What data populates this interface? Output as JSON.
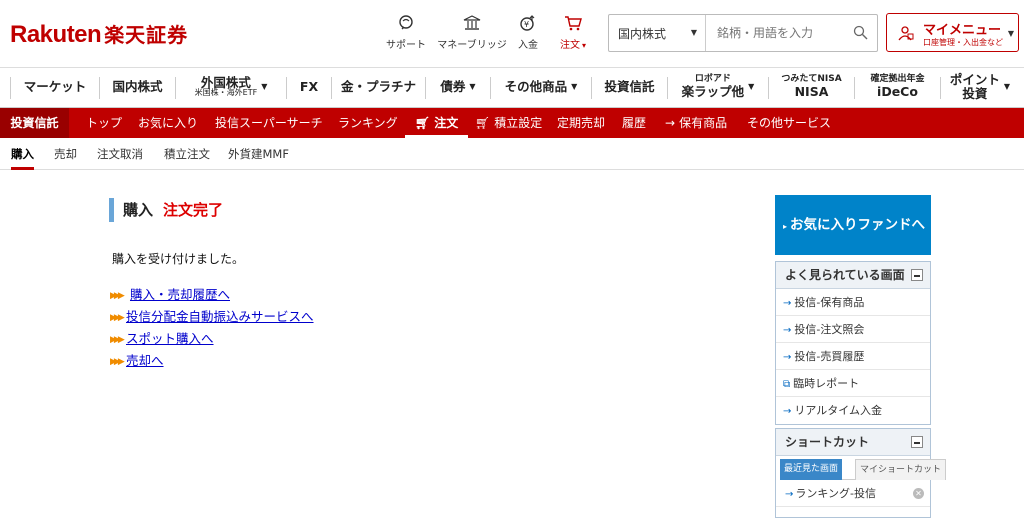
{
  "header": {
    "logo_en": "Rakuten",
    "logo_jp": "楽天証券",
    "icons": [
      {
        "label": "サポート",
        "icon": "support-icon"
      },
      {
        "label": "マネーブリッジ",
        "icon": "bank-icon"
      },
      {
        "label": "入金",
        "icon": "deposit-icon"
      },
      {
        "label": "注文",
        "icon": "cart-icon"
      }
    ],
    "order_caret": "▾",
    "search": {
      "category": "国内株式",
      "placeholder": "銘柄・用語を入力"
    },
    "mymenu": {
      "title": "マイメニュー",
      "subtitle": "口座管理・入出金など"
    }
  },
  "main_nav": [
    {
      "label": "マーケット"
    },
    {
      "label": "国内株式"
    },
    {
      "label": "外国株式",
      "sub": "米国株・海外ETF",
      "caret": true
    },
    {
      "label": "FX"
    },
    {
      "label": "金・プラチナ"
    },
    {
      "label": "債券",
      "caret": true
    },
    {
      "label": "その他商品",
      "caret": true
    },
    {
      "label": "投資信託"
    },
    {
      "label": "楽ラップ他",
      "pre": "ロボアド",
      "caret": true
    },
    {
      "label": "NISA",
      "pre": "つみたてNISA"
    },
    {
      "label": "iDeCo",
      "pre": "確定拠出年金"
    },
    {
      "label": "投資",
      "pre": "ポイント",
      "caret": true
    }
  ],
  "red_nav": {
    "first": "投資信託",
    "items": [
      "トップ",
      "お気に入り",
      "投信スーパーサーチ",
      "ランキング",
      "注文",
      "積立設定",
      "定期売却",
      "履歴",
      "保有商品",
      "その他サービス"
    ]
  },
  "sub_nav": [
    "購入",
    "売却",
    "注文取消",
    "積立注文",
    "外貨建MMF"
  ],
  "page": {
    "title": "購入",
    "status": "注文完了",
    "message": "購入を受け付けました。",
    "links": [
      "購入・売却履歴へ",
      "投信分配金自動振込みサービスへ",
      "スポット購入へ",
      "売却へ"
    ]
  },
  "sidebar": {
    "fav_button": "お気に入りファンドへ",
    "frequent": {
      "title": "よく見られている画面",
      "items": [
        "投信-保有商品",
        "投信-注文照会",
        "投信-売買履歴",
        "臨時レポート",
        "リアルタイム入金"
      ]
    },
    "shortcut": {
      "title": "ショートカット",
      "tabs": [
        "最近見た画面",
        "マイショートカット"
      ],
      "items": [
        "ランキング-投信"
      ]
    }
  },
  "colors": {
    "brand": "#bf0000",
    "accent": "#0083c9",
    "link": "#0000cc"
  }
}
